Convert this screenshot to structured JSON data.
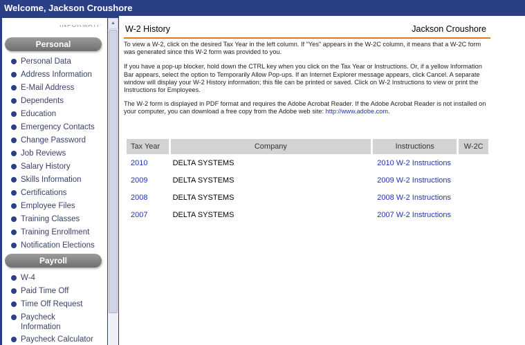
{
  "window": {
    "welcome": "Welcome, Jackson Croushore"
  },
  "sidebar": {
    "clipped_text": "INFORMATIVE",
    "sections": [
      {
        "title": "Personal",
        "items": [
          "Personal Data",
          "Address Information",
          "E-Mail Address",
          "Dependents",
          "Education",
          "Emergency Contacts",
          "Change Password",
          "Job Reviews",
          "Salary History",
          "Skills Information",
          "Certifications",
          "Employee Files",
          "Training Classes",
          "Training Enrollment",
          "Notification Elections"
        ]
      },
      {
        "title": "Payroll",
        "items": [
          "W-4",
          "Paid Time Off",
          "Time Off Request",
          "Paycheck Information",
          "Paycheck Calculator"
        ]
      }
    ]
  },
  "main": {
    "title": "W-2 History",
    "user": "Jackson Croushore",
    "para1": "To view a W-2, click on the desired Tax Year in the left column. If \"Yes\" appears in the W-2C column, it means that a W-2C form was generated since this W-2 form was provided to you.",
    "para2": "If you have a pop-up blocker, hold down the CTRL key when you click on the Tax Year or Instructions. Or, if a yellow Information Bar appears, select the option to Temporarily Allow Pop-ups. If an Internet Explorer message appears, click Cancel. A separate window will display your W-2 History information; this file can be printed or saved. Click on W-2 Instructions to view or print the Instructions for Employees.",
    "para3_prefix": "The W-2 form is displayed in PDF format and requires the Adobe Acrobat Reader. If the Adobe Acrobat Reader is not installed on your computer, you can download a free copy from the Adobe web site: ",
    "para3_link": "http://www.adobe.com",
    "para3_suffix": ".",
    "table": {
      "headers": {
        "year": "Tax Year",
        "company": "Company",
        "instructions": "Instructions",
        "w2c": "W-2C"
      },
      "rows": [
        {
          "year": "2010",
          "company": "DELTA SYSTEMS",
          "instructions": "2010 W-2 Instructions",
          "w2c": ""
        },
        {
          "year": "2009",
          "company": "DELTA SYSTEMS",
          "instructions": "2009 W-2 Instructions",
          "w2c": ""
        },
        {
          "year": "2008",
          "company": "DELTA SYSTEMS",
          "instructions": "2008 W-2 Instructions",
          "w2c": ""
        },
        {
          "year": "2007",
          "company": "DELTA SYSTEMS",
          "instructions": "2007 W-2 Instructions",
          "w2c": ""
        }
      ]
    }
  },
  "colors": {
    "header_bg": "#2a3f85",
    "accent_line": "#e07a1f",
    "link": "#2233aa",
    "pill": "#808080"
  }
}
